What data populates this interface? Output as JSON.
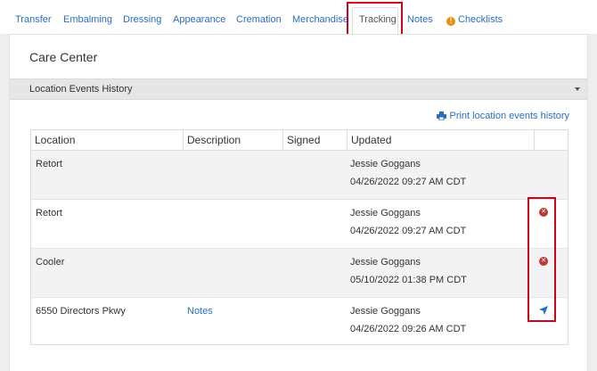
{
  "tabs": [
    {
      "label": "Transfer"
    },
    {
      "label": "Embalming"
    },
    {
      "label": "Dressing"
    },
    {
      "label": "Appearance"
    },
    {
      "label": "Cremation"
    },
    {
      "label": "Merchandise"
    },
    {
      "label": "Tracking",
      "active": true
    },
    {
      "label": "Notes"
    },
    {
      "label": "Checklists",
      "icon": "warning-icon"
    }
  ],
  "panel": {
    "title": "Care Center",
    "section_label": "Location Events History",
    "print_label": "Print location events history"
  },
  "table": {
    "columns": [
      "Location",
      "Description",
      "Signed",
      "Updated"
    ],
    "rows": [
      {
        "location": "Retort",
        "description": "",
        "signed": "",
        "updated_by": "Jessie Goggans",
        "updated_at": "04/26/2022 09:27 AM CDT",
        "action": ""
      },
      {
        "location": "Retort",
        "description": "",
        "signed": "",
        "updated_by": "Jessie Goggans",
        "updated_at": "04/26/2022 09:27 AM CDT",
        "action": "remove-icon"
      },
      {
        "location": "Cooler",
        "description": "",
        "signed": "",
        "updated_by": "Jessie Goggans",
        "updated_at": "05/10/2022 01:38 PM CDT",
        "action": "remove-icon"
      },
      {
        "location": "6550 Directors Pkwy",
        "description": "Notes",
        "signed": "",
        "updated_by": "Jessie Goggans",
        "updated_at": "04/26/2022 09:26 AM CDT",
        "action": "location-arrow-icon"
      }
    ]
  },
  "colors": {
    "link": "#2a6ebb",
    "highlight": "#d0021b",
    "remove": "#b83a36",
    "warning": "#e8900c"
  }
}
